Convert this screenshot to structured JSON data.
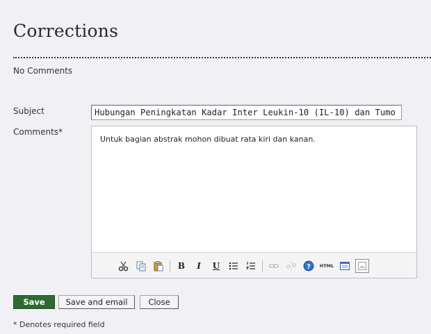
{
  "page": {
    "title": "Corrections",
    "no_comments_text": "No Comments"
  },
  "form": {
    "subject_label": "Subject",
    "subject_value": "Hubungan Peningkatan Kadar Inter Leukin-10 (IL-10) dan Tumo",
    "comments_label": "Comments*",
    "comments_value": "Untuk bagian abstrak mohon dibuat rata kiri dan kanan."
  },
  "toolbar": {
    "buttons": [
      {
        "icon": "cut-icon"
      },
      {
        "icon": "copy-icon"
      },
      {
        "icon": "paste-icon"
      },
      {
        "icon": "bold-icon",
        "glyph": "B"
      },
      {
        "icon": "italic-icon",
        "glyph": "I"
      },
      {
        "icon": "underline-icon",
        "glyph": "U"
      },
      {
        "icon": "bullet-list-icon"
      },
      {
        "icon": "numbered-list-icon"
      },
      {
        "icon": "link-icon"
      },
      {
        "icon": "unlink-icon"
      },
      {
        "icon": "help-icon"
      },
      {
        "icon": "html-icon",
        "glyph": "HTML"
      },
      {
        "icon": "fullscreen-icon"
      },
      {
        "icon": "image-icon"
      }
    ]
  },
  "actions": {
    "save_label": "Save",
    "save_email_label": "Save and email",
    "close_label": "Close"
  },
  "footer": {
    "required_note": "* Denotes required field"
  },
  "colors": {
    "background": "#f1f1f5",
    "save_button": "#2e6b32"
  }
}
